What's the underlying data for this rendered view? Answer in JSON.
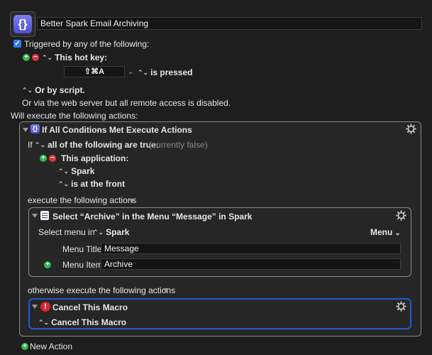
{
  "macro": {
    "name": "Better Spark Email Archiving",
    "icon": "curly-braces-icon",
    "trigger_label": "Triggered by any of the following:",
    "hotkey_label": "This hot key:",
    "hotkey_value": "⇧⌘A",
    "hotkey_state": "is pressed",
    "by_script": "Or by script.",
    "web_server_note": "Or via the web server but all remote access is disabled.",
    "will_execute": "Will execute the following actions:",
    "new_action": "New Action"
  },
  "if_block": {
    "title": "If All Conditions Met Execute Actions",
    "if_word": "If",
    "condition_mode": "all of the following are true:",
    "status": "(currently false)",
    "condition_type": "This application:",
    "app": "Spark",
    "app_state": "is at the front",
    "execute_label": "execute the following actions",
    "otherwise_label": "otherwise execute the following actions"
  },
  "menu_action": {
    "title": "Select “Archive” in the Menu “Message” in Spark",
    "select_menu_in": "Select menu in",
    "app": "Spark",
    "menu_dropdown": "Menu",
    "menu_title_label": "Menu Title",
    "menu_title_value": "Message",
    "menu_item_label": "Menu Item",
    "menu_item_value": "Archive"
  },
  "cancel_action": {
    "title": "Cancel This Macro",
    "option": "Cancel This Macro"
  },
  "colors": {
    "accent_blue": "#1e5bd6",
    "plus_green": "#2eb84a",
    "minus_red": "#e0383e",
    "checkbox_blue": "#2f7bf6"
  }
}
